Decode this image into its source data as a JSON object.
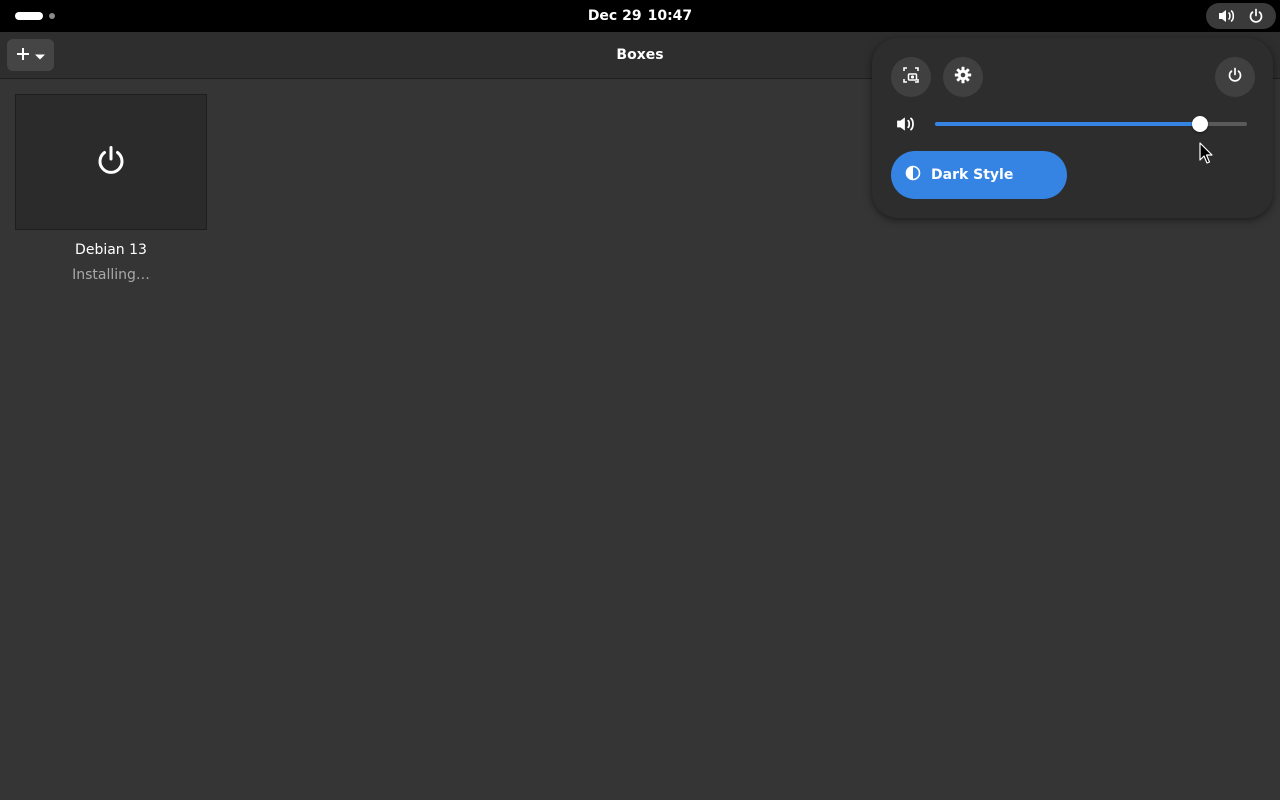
{
  "topbar": {
    "date": "Dec 29",
    "time": "10:47",
    "status_icons": [
      "volume-icon",
      "power-icon"
    ]
  },
  "app": {
    "title": "Boxes",
    "add_button_icon": "plus-icon"
  },
  "machines": [
    {
      "name": "Debian 13",
      "status": "Installing…",
      "icon": "power-icon"
    }
  ],
  "quick_settings": {
    "buttons": [
      "screenshot-icon",
      "gear-icon",
      "power-icon"
    ],
    "volume_level": 0.85,
    "dark_style_label": "Dark Style",
    "dark_style_enabled": true
  },
  "colors": {
    "accent": "#3584e4",
    "background": "#353535",
    "topbar": "#000000"
  }
}
